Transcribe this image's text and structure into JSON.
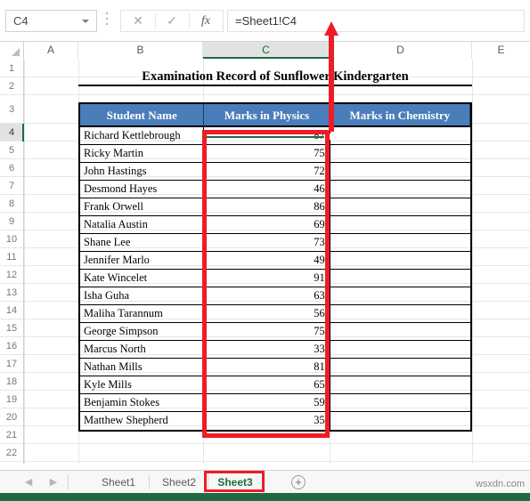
{
  "formula_bar": {
    "name_box_value": "C4",
    "formula_value": "=Sheet1!C4",
    "cancel_icon": "close-icon",
    "accept_icon": "check-icon",
    "fx_label": "fx"
  },
  "columns": [
    {
      "label": "A",
      "selected": false
    },
    {
      "label": "B",
      "selected": false
    },
    {
      "label": "C",
      "selected": true
    },
    {
      "label": "D",
      "selected": false
    },
    {
      "label": "E",
      "selected": false
    }
  ],
  "rows": [
    "1",
    "2",
    "3",
    "4",
    "5",
    "6",
    "7",
    "8",
    "9",
    "10",
    "11",
    "12",
    "13",
    "14",
    "15",
    "16",
    "17",
    "18",
    "19",
    "20",
    "21",
    "22"
  ],
  "selected_row": "4",
  "sheet": {
    "title": "Examination Record of Sunflower Kindergarten",
    "headers": [
      "Student Name",
      "Marks in Physics",
      "Marks in Chemistry"
    ],
    "data": [
      {
        "name": "Richard Kettlebrough",
        "physics": "87",
        "chemistry": ""
      },
      {
        "name": "Ricky Martin",
        "physics": "75",
        "chemistry": ""
      },
      {
        "name": "John Hastings",
        "physics": "72",
        "chemistry": ""
      },
      {
        "name": "Desmond Hayes",
        "physics": "46",
        "chemistry": ""
      },
      {
        "name": "Frank Orwell",
        "physics": "86",
        "chemistry": ""
      },
      {
        "name": "Natalia Austin",
        "physics": "69",
        "chemistry": ""
      },
      {
        "name": "Shane Lee",
        "physics": "73",
        "chemistry": ""
      },
      {
        "name": "Jennifer Marlo",
        "physics": "49",
        "chemistry": ""
      },
      {
        "name": "Kate Wincelet",
        "physics": "91",
        "chemistry": ""
      },
      {
        "name": "Isha Guha",
        "physics": "63",
        "chemistry": ""
      },
      {
        "name": "Maliha Tarannum",
        "physics": "56",
        "chemistry": ""
      },
      {
        "name": "George Simpson",
        "physics": "75",
        "chemistry": ""
      },
      {
        "name": "Marcus North",
        "physics": "33",
        "chemistry": ""
      },
      {
        "name": "Nathan Mills",
        "physics": "81",
        "chemistry": ""
      },
      {
        "name": "Kyle Mills",
        "physics": "65",
        "chemistry": ""
      },
      {
        "name": "Benjamin Stokes",
        "physics": "59",
        "chemistry": ""
      },
      {
        "name": "Matthew Shepherd",
        "physics": "35",
        "chemistry": ""
      }
    ],
    "header_bg_color": "#4a7ebb",
    "header_text_color": "#ffffff"
  },
  "annotations": {
    "highlight_color": "#ee1c25",
    "column_highlight": "Marks in Physics column C4:C20",
    "arrow": "up-arrow pointing at column C header"
  },
  "tab_bar": {
    "prev_icon": "chevron-left-icon",
    "next_icon": "chevron-right-icon",
    "tabs": [
      {
        "label": "Sheet1",
        "active": false
      },
      {
        "label": "Sheet2",
        "active": false
      },
      {
        "label": "Sheet3",
        "active": true
      }
    ],
    "add_sheet_label": "+",
    "active_tab_color": "#17703a"
  },
  "watermark": "wsxdn.com"
}
